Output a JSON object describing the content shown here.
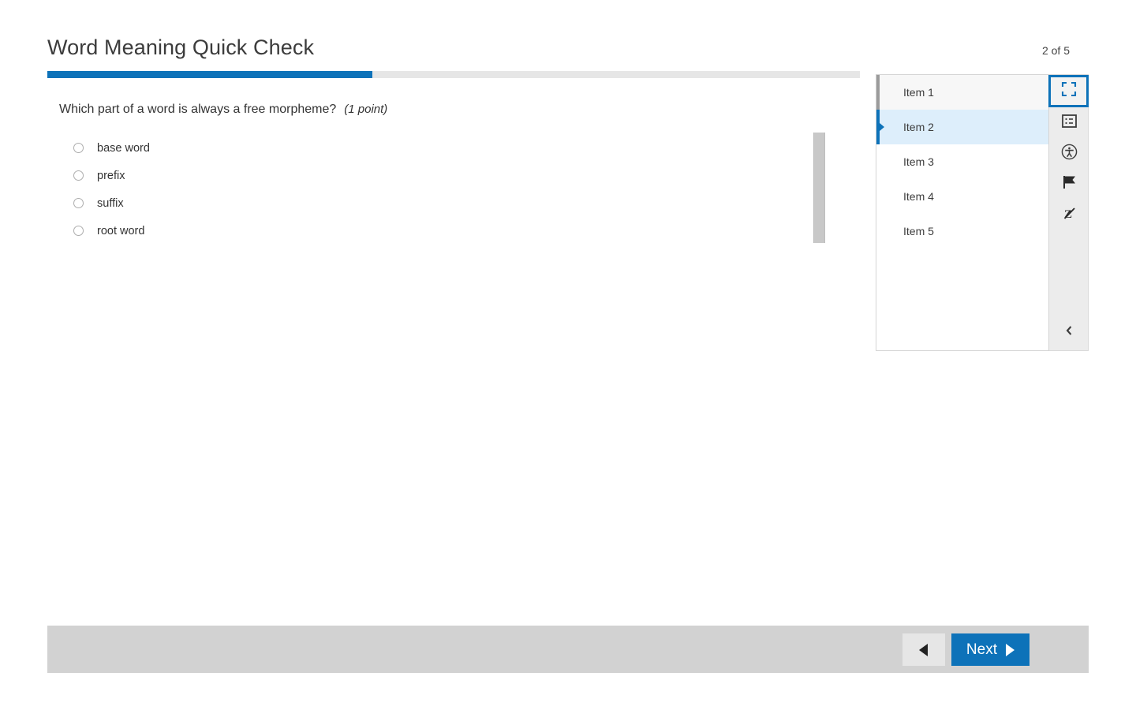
{
  "header": {
    "title": "Word Meaning Quick Check",
    "counter": "2 of 5",
    "progress_percent": 40,
    "accent_color": "#0d72b9"
  },
  "question": {
    "stem": "Which part of a word is always a free morpheme?",
    "points": "(1 point)",
    "choices": [
      {
        "label": "base word",
        "selected": false
      },
      {
        "label": "prefix",
        "selected": false
      },
      {
        "label": "suffix",
        "selected": false
      },
      {
        "label": "root word",
        "selected": false
      }
    ]
  },
  "item_panel": {
    "items": [
      {
        "label": "Item 1",
        "state": "visited"
      },
      {
        "label": "Item 2",
        "state": "current"
      },
      {
        "label": "Item 3",
        "state": "unvisited"
      },
      {
        "label": "Item 4",
        "state": "unvisited"
      },
      {
        "label": "Item 5",
        "state": "unvisited"
      }
    ]
  },
  "toolbar": {
    "tools": [
      {
        "icon": "fullscreen-icon",
        "active": true
      },
      {
        "icon": "notes-icon",
        "active": false
      },
      {
        "icon": "accessibility-icon",
        "active": false
      },
      {
        "icon": "flag-icon",
        "active": false
      },
      {
        "icon": "line-reader-icon",
        "active": false
      }
    ],
    "collapse_icon": "chevron-left-icon"
  },
  "footer": {
    "prev_label": "",
    "next_label": "Next"
  }
}
